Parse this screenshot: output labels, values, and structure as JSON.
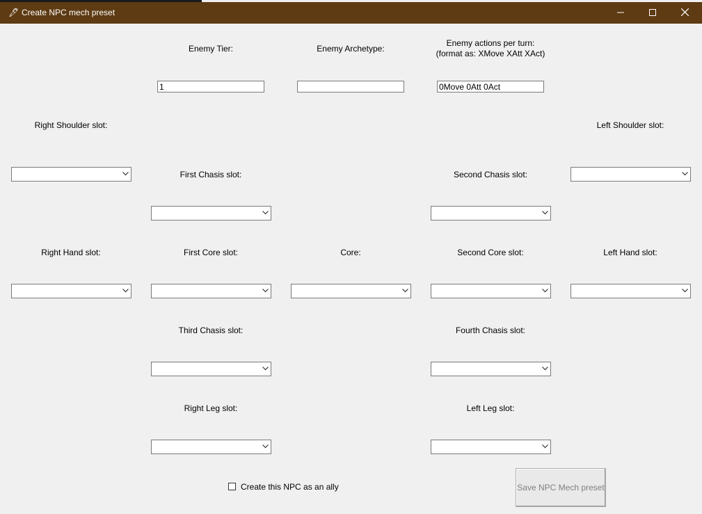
{
  "window": {
    "title": "Create NPC mech preset",
    "icons": {
      "app": "feather-icon",
      "minimize": "minimize-icon",
      "maximize": "maximize-icon",
      "close": "close-icon"
    }
  },
  "header": {
    "tier_label": "Enemy Tier:",
    "tier_value": "1",
    "archetype_label": "Enemy Archetype:",
    "archetype_value": "",
    "actions_label_line1": "Enemy actions per turn:",
    "actions_label_line2": "(format as: XMove XAtt XAct)",
    "actions_value": "0Move 0Att 0Act"
  },
  "slots": {
    "right_shoulder": {
      "label": "Right Shoulder slot:",
      "value": ""
    },
    "left_shoulder": {
      "label": "Left Shoulder slot:",
      "value": ""
    },
    "first_chasis": {
      "label": "First Chasis slot:",
      "value": ""
    },
    "second_chasis": {
      "label": "Second Chasis slot:",
      "value": ""
    },
    "right_hand": {
      "label": "Right Hand slot:",
      "value": ""
    },
    "first_core": {
      "label": "First Core slot:",
      "value": ""
    },
    "core": {
      "label": "Core:",
      "value": ""
    },
    "second_core": {
      "label": "Second Core slot:",
      "value": ""
    },
    "left_hand": {
      "label": "Left Hand slot:",
      "value": ""
    },
    "third_chasis": {
      "label": "Third Chasis slot:",
      "value": ""
    },
    "fourth_chasis": {
      "label": "Fourth Chasis slot:",
      "value": ""
    },
    "right_leg": {
      "label": "Right Leg slot:",
      "value": ""
    },
    "left_leg": {
      "label": "Left Leg slot:",
      "value": ""
    }
  },
  "footer": {
    "ally_checkbox_label": "Create this NPC as an ally",
    "ally_checked": false,
    "save_button_label": "Save NPC Mech preset"
  }
}
